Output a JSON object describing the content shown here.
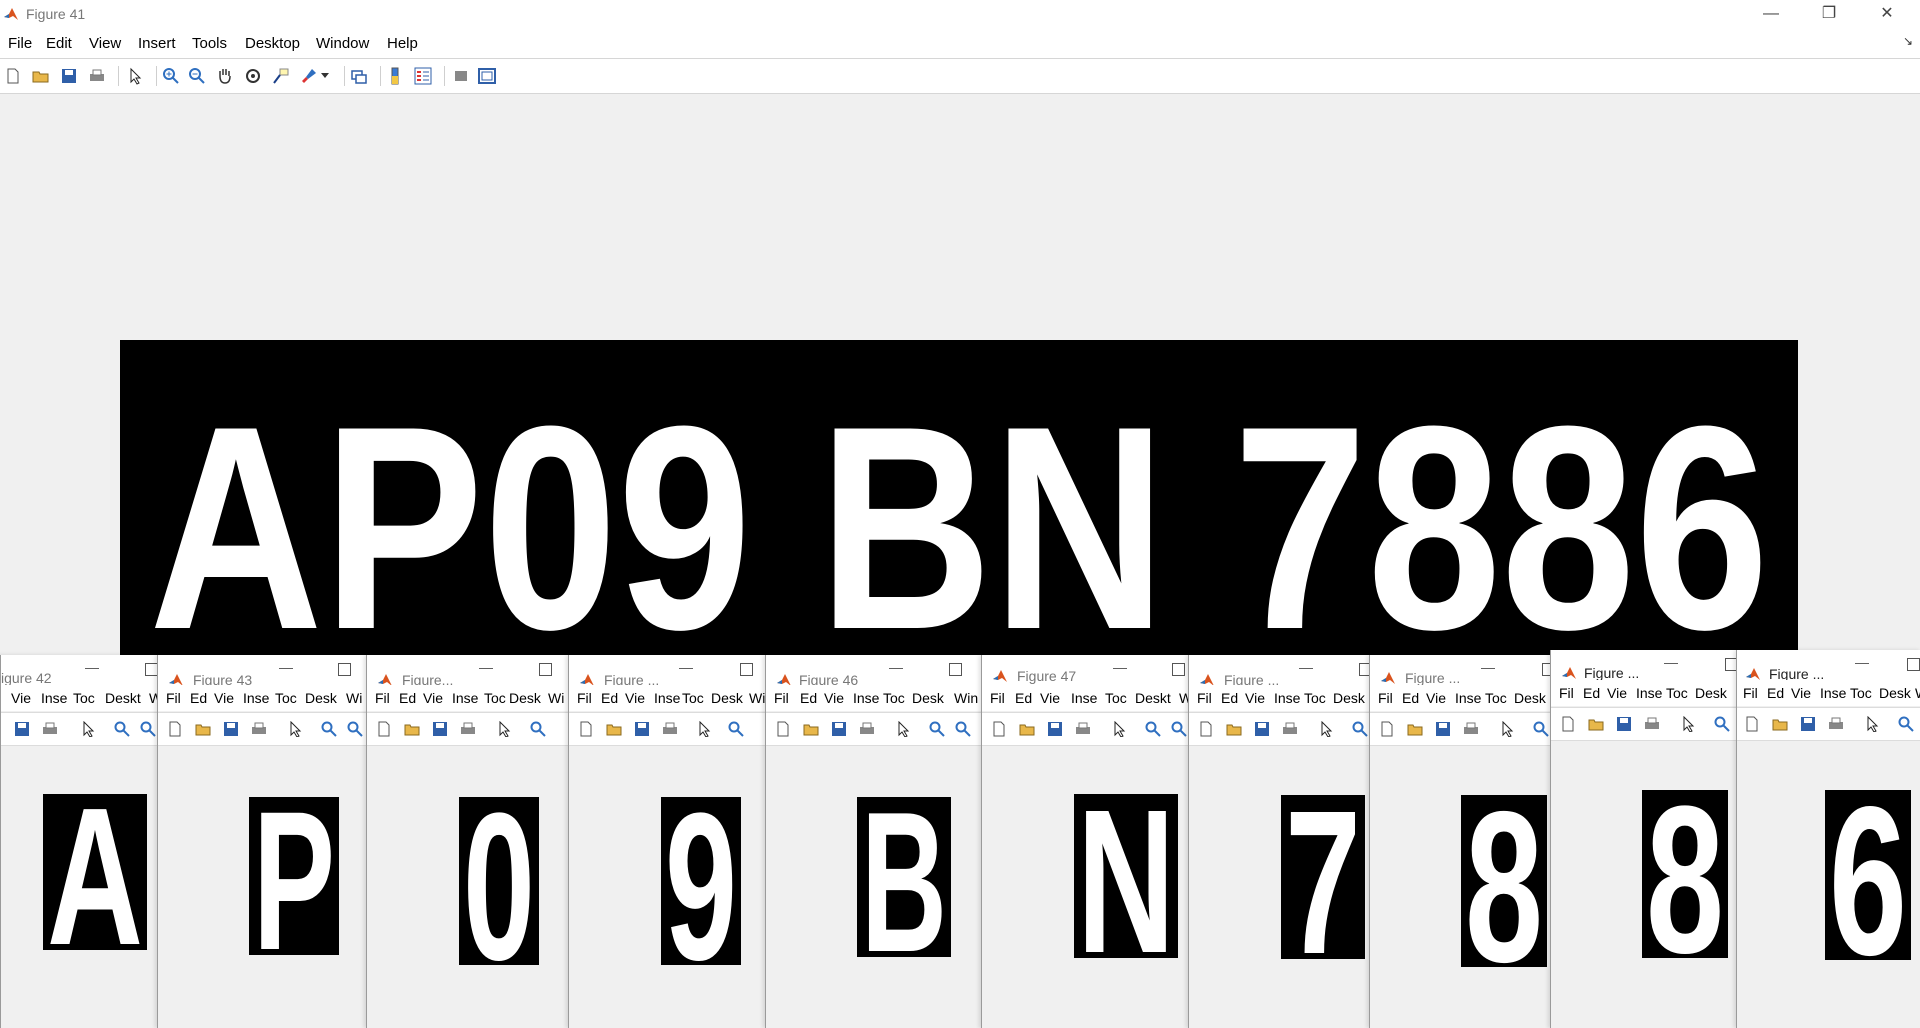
{
  "main_window": {
    "title": "Figure 41",
    "menu": [
      "File",
      "Edit",
      "View",
      "Insert",
      "Tools",
      "Desktop",
      "Window",
      "Help"
    ],
    "window_controls": {
      "minimize": "—",
      "restore": "❐",
      "close": "✕"
    },
    "plate_text": "AP09 BN 7886"
  },
  "toolbar_icons": [
    "new-figure-icon",
    "open-file-icon",
    "save-icon",
    "print-icon",
    "pointer-icon",
    "zoom-in-icon",
    "zoom-out-icon",
    "pan-hand-icon",
    "rotate-3d-icon",
    "data-cursor-icon",
    "brush-icon",
    "brush-dropdown-icon",
    "link-plot-icon",
    "colorbar-icon",
    "legend-icon",
    "hide-plot-tools-icon",
    "show-plot-tools-icon"
  ],
  "child_windows": [
    {
      "title": "igure 42",
      "menu": [
        "",
        "Vie",
        "Inse",
        "Toc",
        "Deskt",
        "W"
      ],
      "char": "A"
    },
    {
      "title": "Figure 43",
      "menu": [
        "Fil",
        "Ed",
        "Vie",
        "Inse",
        "Toc",
        "Desk",
        "Wi"
      ],
      "char": "P"
    },
    {
      "title": "Figure...",
      "menu": [
        "Fil",
        "Ed",
        "Vie",
        "Inse",
        "Toc",
        "Desk",
        "Wi"
      ],
      "char": "0"
    },
    {
      "title": "Figure ...",
      "menu": [
        "Fil",
        "Ed",
        "Vie",
        "Inse",
        "Toc",
        "Desk",
        "Wi"
      ],
      "char": "9"
    },
    {
      "title": "Figure 46",
      "menu": [
        "Fil",
        "Ed",
        "Vie",
        "Inse",
        "Toc",
        "Desk",
        "Win"
      ],
      "char": "B"
    },
    {
      "title": "Figure 47",
      "menu": [
        "Fil",
        "Ed",
        "Vie",
        "Inse",
        "Toc",
        "Deskt",
        "W"
      ],
      "char": "N"
    },
    {
      "title": "Figure ...",
      "menu": [
        "Fil",
        "Ed",
        "Vie",
        "Inse",
        "Toc",
        "Desk"
      ],
      "char": "7"
    },
    {
      "title": "Figure ...",
      "menu": [
        "Fil",
        "Ed",
        "Vie",
        "Inse",
        "Toc",
        "Desk"
      ],
      "char": "8"
    },
    {
      "title": "Figure ...",
      "menu": [
        "Fil",
        "Ed",
        "Vie",
        "Inse",
        "Toc",
        "Desk"
      ],
      "char": "8"
    },
    {
      "title": "Figure ...",
      "menu": [
        "Fil",
        "Ed",
        "Vie",
        "Inse",
        "Toc",
        "Desk",
        "W"
      ],
      "char": "6"
    }
  ]
}
